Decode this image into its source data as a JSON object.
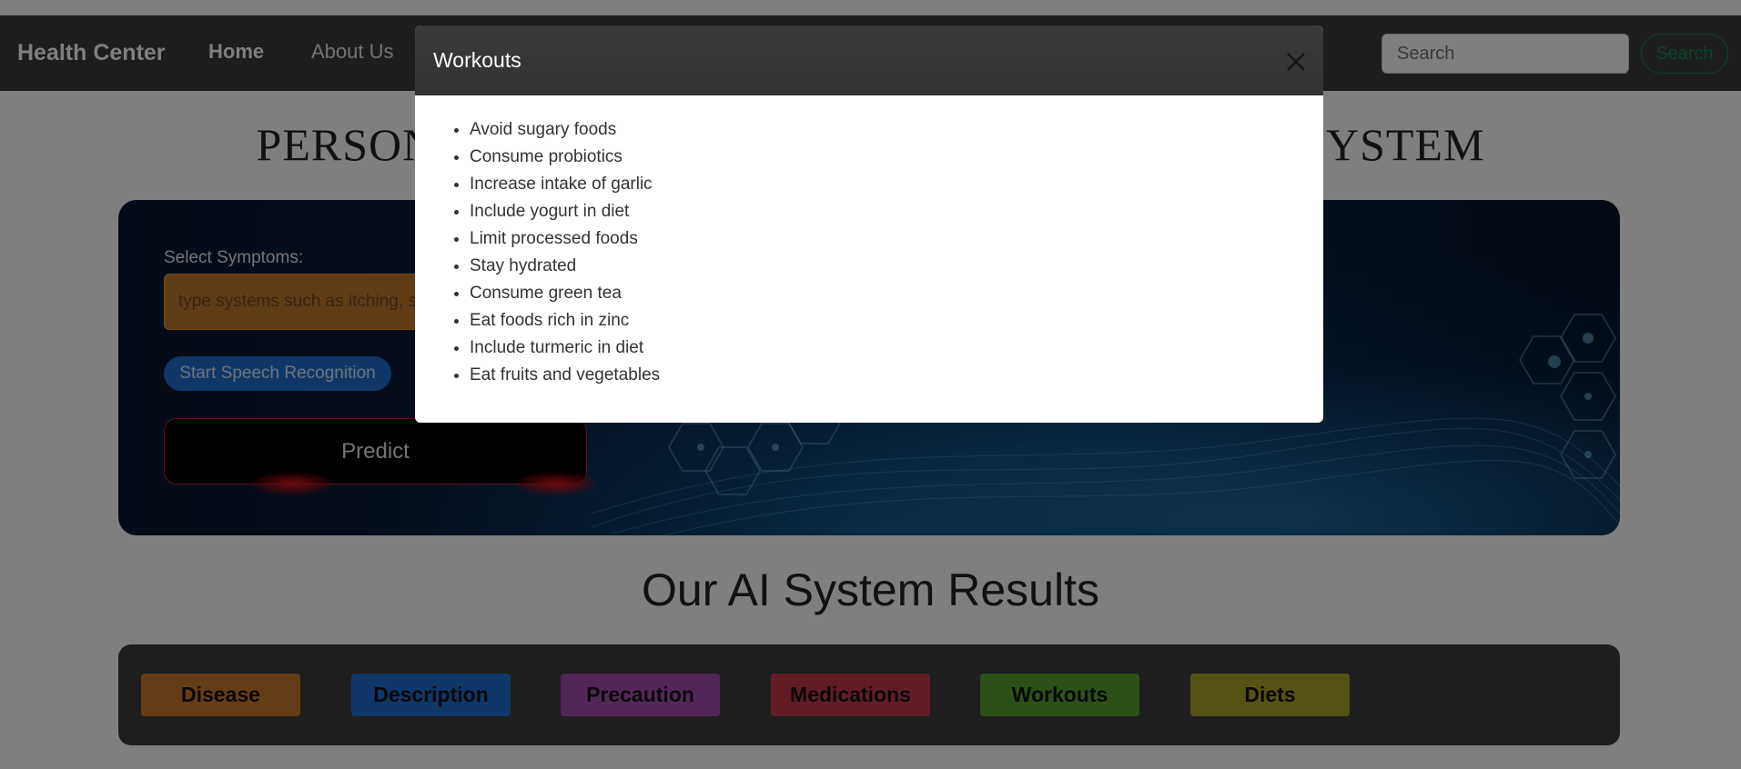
{
  "navbar": {
    "brand": "Health Center",
    "links": [
      "Home",
      "About Us"
    ],
    "search_placeholder": "Search",
    "search_button": "Search"
  },
  "main_title": "PERSONALIZED MEDICAL RECOMMENDATION SYSTEM",
  "form": {
    "symptoms_label": "Select Symptoms:",
    "symptoms_placeholder": "type systems such as itching, sleeping, aching etc",
    "speech_button": "Start Speech Recognition",
    "predict_button": "Predict"
  },
  "results": {
    "title": "Our AI System Results",
    "buttons": [
      {
        "label": "Disease",
        "color": "#c97a2c"
      },
      {
        "label": "Description",
        "color": "#1f6fd0"
      },
      {
        "label": "Precaution",
        "color": "#a54fb0"
      },
      {
        "label": "Medications",
        "color": "#c6394a"
      },
      {
        "label": "Workouts",
        "color": "#5aa02c"
      },
      {
        "label": "Diets",
        "color": "#a8a628"
      }
    ]
  },
  "modal": {
    "title": "Workouts",
    "items": [
      "Avoid sugary foods",
      "Consume probiotics",
      "Increase intake of garlic",
      "Include yogurt in diet",
      "Limit processed foods",
      "Stay hydrated",
      "Consume green tea",
      "Eat foods rich in zinc",
      "Include turmeric in diet",
      "Eat fruits and vegetables"
    ]
  }
}
